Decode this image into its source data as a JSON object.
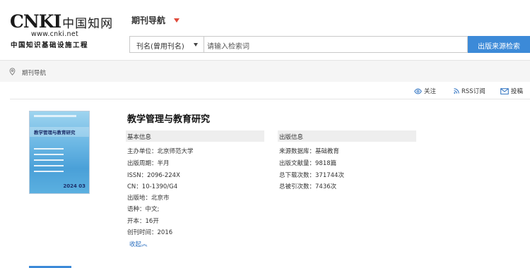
{
  "logo": {
    "brand_latin": "CNKI",
    "brand_cn": "中国知网",
    "url": "www.cnki.net",
    "subtitle": "中国知识基础设施工程"
  },
  "nav": {
    "title": "期刊导航"
  },
  "search": {
    "field": "刊名(曾用刊名)",
    "placeholder": "请输入检索词",
    "button": "出版来源检索"
  },
  "breadcrumb": {
    "label": "期刊导航"
  },
  "actions": {
    "follow": "关注",
    "rss": "RSS订阅",
    "submit": "投稿"
  },
  "journal": {
    "title": "教学管理与教育研究",
    "cover_title": "教学管理与教育研究",
    "cover_issue": "2024 03",
    "basic": {
      "heading": "基本信息",
      "rows": [
        {
          "label": "主办单位：",
          "value": "北京师范大学"
        },
        {
          "label": "出版周期：",
          "value": "半月"
        },
        {
          "label": "ISSN：",
          "value": "2096-224X"
        },
        {
          "label": "CN：",
          "value": "10-1390/G4"
        },
        {
          "label": "出版地：",
          "value": "北京市"
        },
        {
          "label": "语种：",
          "value": "中文;"
        },
        {
          "label": "开本：",
          "value": "16开"
        },
        {
          "label": "创刊时间：",
          "value": "2016"
        }
      ],
      "collapse": "收起︽"
    },
    "publish": {
      "heading": "出版信息",
      "rows": [
        {
          "label": "来源数据库：",
          "value": "基础教育"
        },
        {
          "label": "出版文献量：",
          "value": "9818篇"
        },
        {
          "label": "总下载次数：",
          "value": "371744次"
        },
        {
          "label": "总被引次数：",
          "value": "7436次"
        }
      ]
    }
  },
  "colors": {
    "accent": "#3c8ad8",
    "nav_caret": "#e04a3a",
    "link": "#2a6fc0"
  }
}
